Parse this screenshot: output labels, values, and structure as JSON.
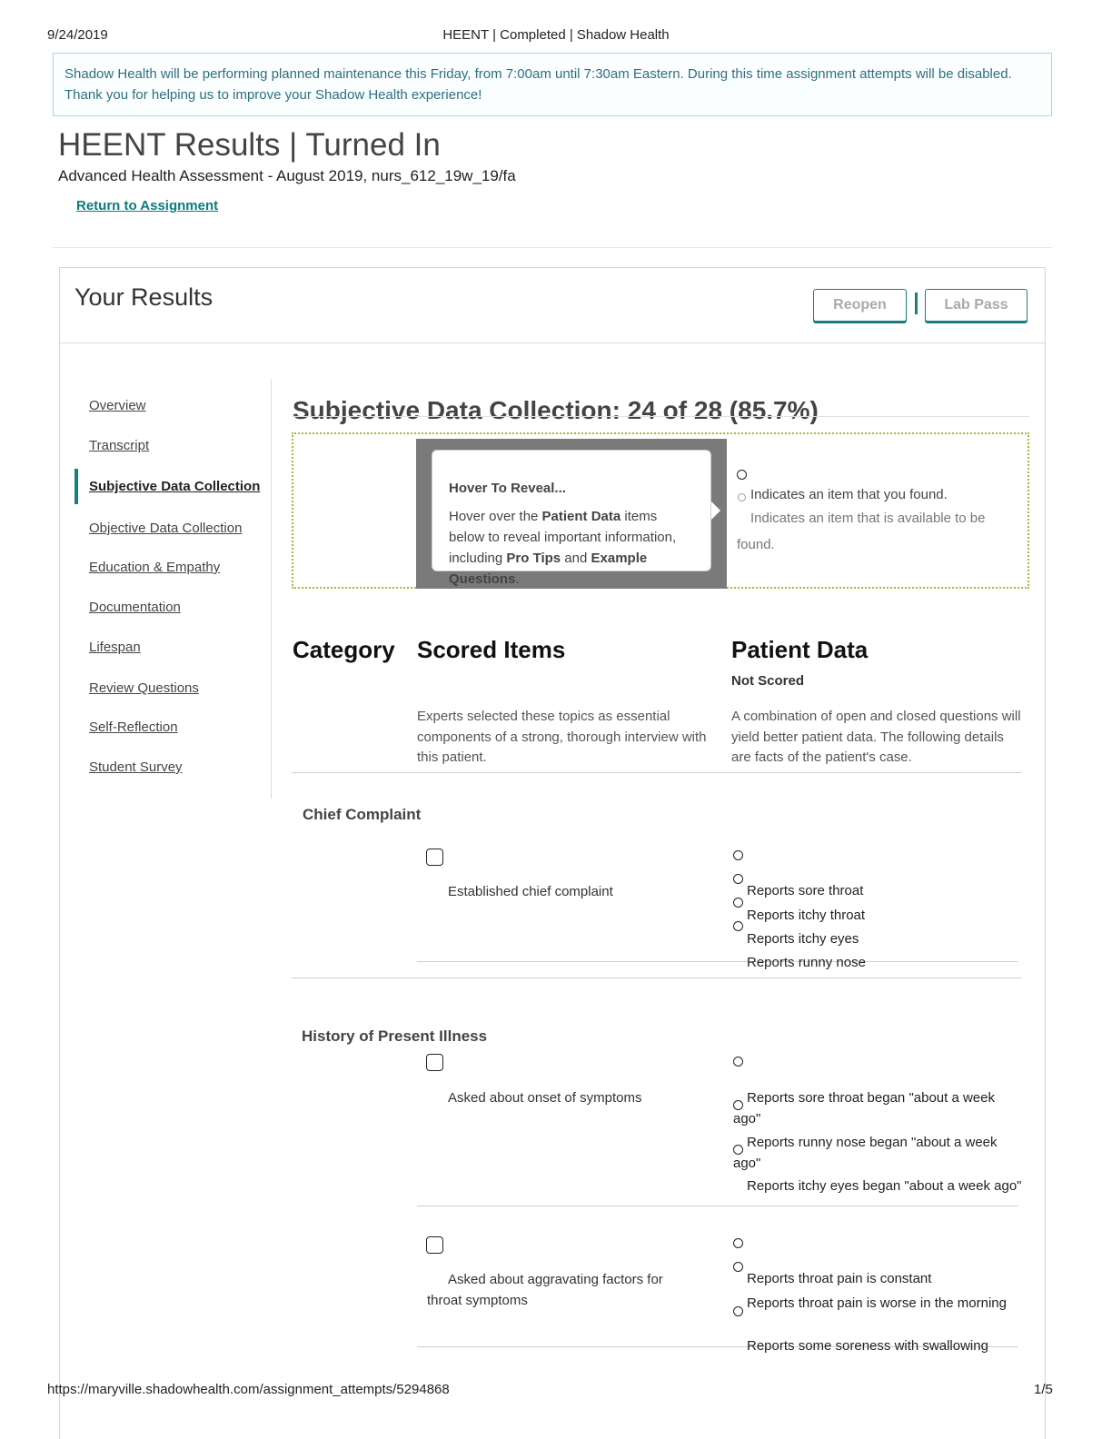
{
  "print_header": {
    "date": "9/24/2019",
    "page_title": "HEENT | Completed | Shadow Health"
  },
  "notice": "Shadow Health will be performing planned maintenance this Friday, from 7:00am until 7:30am Eastern. During this time assignment attempts will be disabled. Thank you for helping us to improve your Shadow Health experience!",
  "page": {
    "title": "HEENT Results | Turned In",
    "subtitle": "Advanced Health Assessment - August 2019, nurs_612_19w_19/fa",
    "return_link": "Return to Assignment"
  },
  "results": {
    "title": "Your Results",
    "reopen_label": "Reopen",
    "lab_pass_label": "Lab Pass"
  },
  "sidebar": {
    "items": [
      {
        "label": "Overview"
      },
      {
        "label": "Transcript"
      },
      {
        "label": "Subjective Data Collection"
      },
      {
        "label": "Objective Data Collection"
      },
      {
        "label": "Education & Empathy"
      },
      {
        "label": "Documentation"
      },
      {
        "label": "Lifespan"
      },
      {
        "label": "Review Questions"
      },
      {
        "label": "Self-Reflection"
      },
      {
        "label": "Student Survey"
      }
    ]
  },
  "section": {
    "title": "Subjective Data Collection: 24 of 28 (85.7%)"
  },
  "tooltip": {
    "heading": "Hover To Reveal...",
    "t1": "Hover over the ",
    "b1": "Patient Data",
    "t2": " items below to reveal important information, including ",
    "b2": "Pro Tips",
    "t3": " and ",
    "b3": "Example Questions",
    "t4": "."
  },
  "legend": {
    "found": "Indicates an item that you found.",
    "available": "Indicates an item that is available to be found."
  },
  "table": {
    "col_category": "Category",
    "col_scored": "Scored Items",
    "col_patient": "Patient Data",
    "not_scored": "Not Scored",
    "scored_desc": "Experts selected these topics as essential components of a strong, thorough interview with this patient.",
    "patient_desc": "A combination of open and closed questions will yield better patient data. The following details are facts of the patient's case."
  },
  "categories": [
    {
      "name": "Chief Complaint",
      "items": [
        {
          "label": "Established chief complaint",
          "patient_data": [
            "Reports sore throat",
            "Reports itchy throat",
            "Reports itchy eyes",
            "Reports runny nose"
          ]
        }
      ]
    },
    {
      "name": "History of Present Illness",
      "items": [
        {
          "label": "Asked about onset of symptoms",
          "patient_data": [
            "Reports sore throat began \"about a week ago\"",
            "Reports runny nose began \"about a week ago\"",
            "Reports itchy eyes began \"about a week ago\""
          ]
        },
        {
          "label": "Asked about aggravating factors for throat symptoms",
          "patient_data": [
            "Reports throat pain is constant",
            "Reports throat pain is worse in the morning",
            "Reports some soreness with swallowing"
          ]
        }
      ]
    }
  ],
  "print_footer": {
    "url": "https://maryville.shadowhealth.com/assignment_attempts/5294868",
    "page": "1/5"
  }
}
